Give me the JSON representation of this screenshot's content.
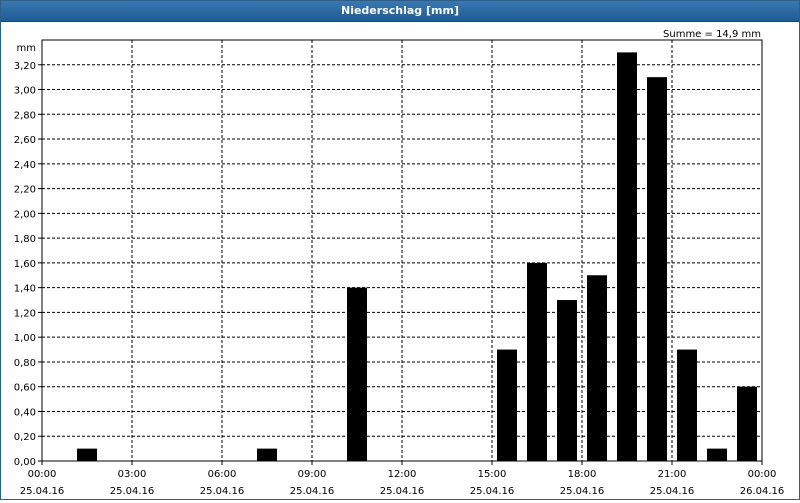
{
  "window": {
    "title": "Niederschlag [mm]"
  },
  "summary": "Summe = 14,9 mm",
  "unit_label": "mm",
  "chart_data": {
    "type": "bar",
    "title": "Niederschlag [mm]",
    "ylabel": "mm",
    "ylim": [
      0,
      3.4
    ],
    "yticks": [
      "0,00",
      "0,20",
      "0,40",
      "0,60",
      "0,80",
      "1,00",
      "1,20",
      "1,40",
      "1,60",
      "1,80",
      "2,00",
      "2,20",
      "2,40",
      "2,60",
      "2,80",
      "3,00",
      "3,20"
    ],
    "xticks": [
      {
        "time": "00:00",
        "date": "25.04.16"
      },
      {
        "time": "03:00",
        "date": "25.04.16"
      },
      {
        "time": "06:00",
        "date": "25.04.16"
      },
      {
        "time": "09:00",
        "date": "25.04.16"
      },
      {
        "time": "12:00",
        "date": "25.04.16"
      },
      {
        "time": "15:00",
        "date": "25.04.16"
      },
      {
        "time": "18:00",
        "date": "25.04.16"
      },
      {
        "time": "21:00",
        "date": "25.04.16"
      },
      {
        "time": "00:00",
        "date": "26.04.16"
      }
    ],
    "x_hours": [
      1,
      2,
      3,
      4,
      5,
      6,
      7,
      8,
      9,
      10,
      11,
      12,
      13,
      14,
      15,
      16,
      17,
      18,
      19,
      20,
      21,
      22,
      23,
      24
    ],
    "values": [
      0,
      0,
      0.1,
      0,
      0,
      0,
      0,
      0,
      0.1,
      0,
      0,
      1.4,
      0,
      0,
      0,
      0,
      0.9,
      1.6,
      1.3,
      1.5,
      3.3,
      3.1,
      0.9,
      0.1,
      0.6
    ],
    "values_note_unused": null,
    "grid": true,
    "bar_color": "#000000",
    "legend": "none"
  }
}
